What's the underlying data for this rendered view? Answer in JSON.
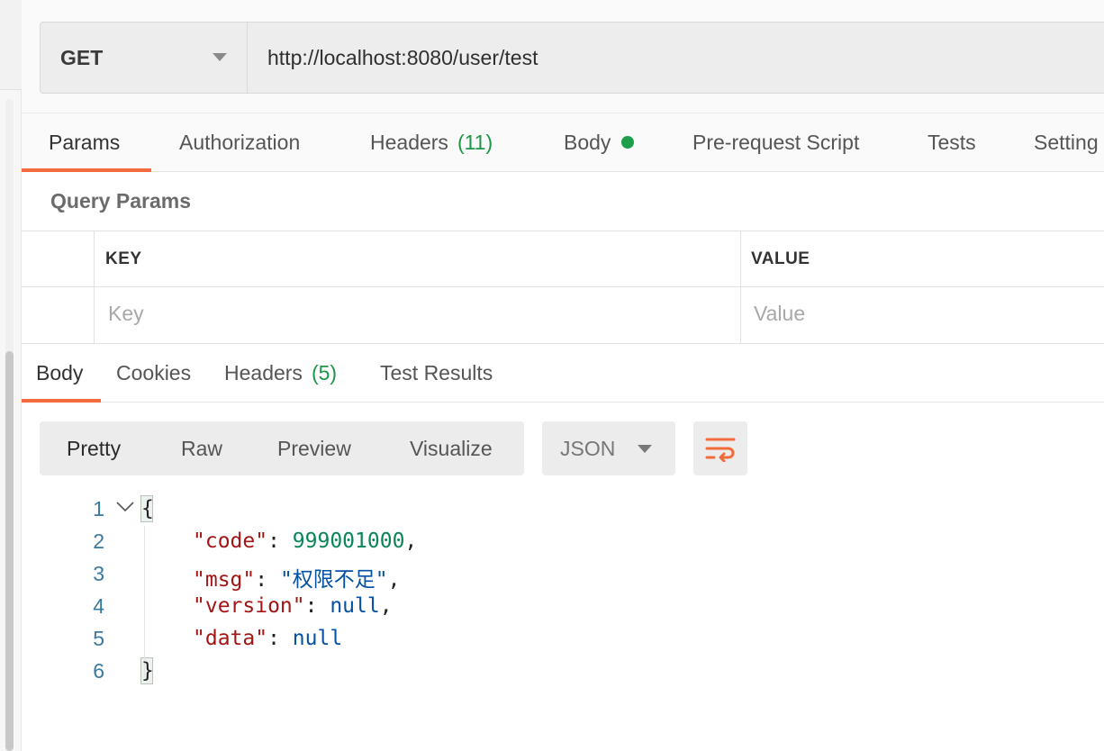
{
  "request": {
    "method": "GET",
    "url": "http://localhost:8080/user/test"
  },
  "request_tabs": [
    {
      "label": "Params",
      "active": true
    },
    {
      "label": "Authorization"
    },
    {
      "label": "Headers",
      "count": "(11)"
    },
    {
      "label": "Body",
      "indicator": "green-dot"
    },
    {
      "label": "Pre-request Script"
    },
    {
      "label": "Tests"
    },
    {
      "label": "Setting"
    }
  ],
  "query_params": {
    "title": "Query Params",
    "columns": [
      "KEY",
      "VALUE"
    ],
    "placeholders": [
      "Key",
      "Value"
    ]
  },
  "response_tabs": [
    {
      "label": "Body",
      "active": true
    },
    {
      "label": "Cookies"
    },
    {
      "label": "Headers",
      "count": "(5)"
    },
    {
      "label": "Test Results"
    }
  ],
  "view_modes": [
    "Pretty",
    "Raw",
    "Preview",
    "Visualize"
  ],
  "active_view_mode": "Pretty",
  "format": "JSON",
  "icons": {
    "method_dropdown": "chevron-down-icon",
    "format_dropdown": "chevron-down-icon",
    "wrap": "wrap-lines-icon",
    "fold": "fold-chevron-icon"
  },
  "colors": {
    "accent": "#f26b3a",
    "count_green": "#1e9647",
    "json_key": "#a31515",
    "json_number": "#098658",
    "json_string": "#0451a5"
  },
  "response_body": {
    "line_numbers": [
      "1",
      "2",
      "3",
      "4",
      "5",
      "6"
    ],
    "open_brace": "{",
    "close_brace": "}",
    "fields": [
      {
        "key": "\"code\"",
        "value": "999001000",
        "type": "number",
        "trail": ","
      },
      {
        "key": "\"msg\"",
        "value": "\"权限不足\"",
        "type": "string",
        "trail": ","
      },
      {
        "key": "\"version\"",
        "value": "null",
        "type": "literal",
        "trail": ","
      },
      {
        "key": "\"data\"",
        "value": "null",
        "type": "literal",
        "trail": ""
      }
    ]
  }
}
